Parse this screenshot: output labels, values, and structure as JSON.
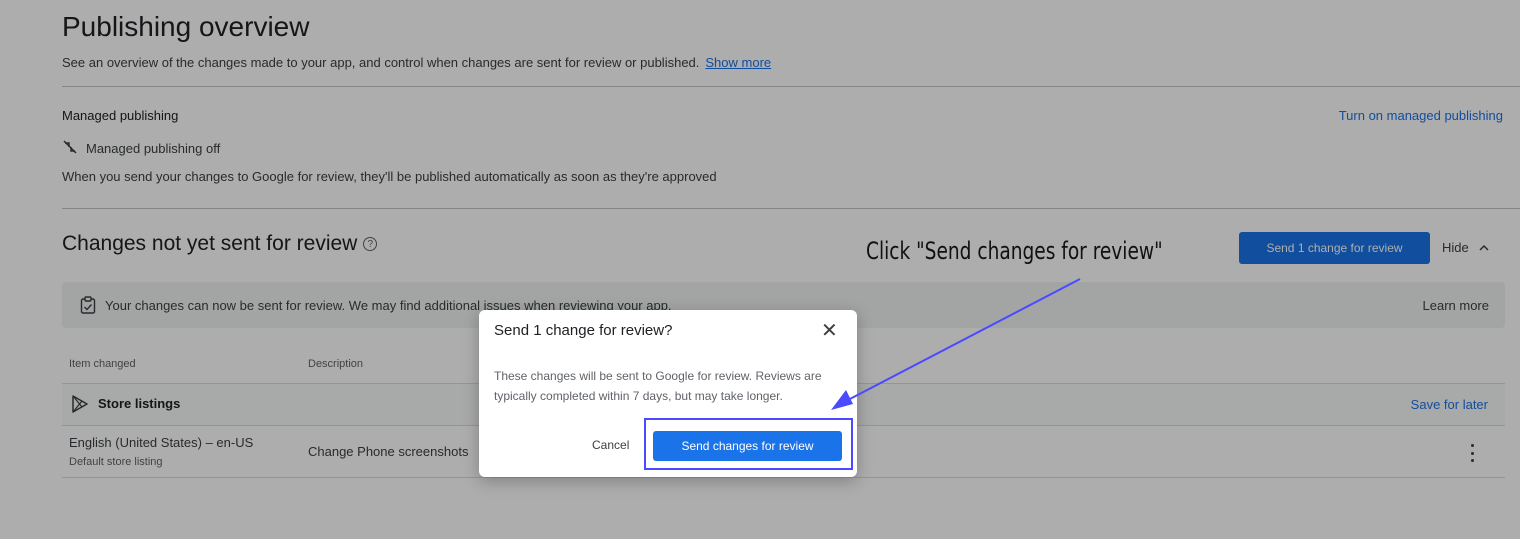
{
  "header": {
    "title": "Publishing overview",
    "subtitle": "See an overview of the changes made to your app, and control when changes are sent for review or published.",
    "show_more": "Show more"
  },
  "managed_publishing": {
    "heading": "Managed publishing",
    "turn_on_link": "Turn on managed publishing",
    "status": "Managed publishing off",
    "status_icon": "sync-off-icon",
    "description": "When you send your changes to Google for review, they'll be published automatically as soon as they're approved"
  },
  "changes_section": {
    "title": "Changes not yet sent for review",
    "help_glyph": "?",
    "send_button": "Send 1 change for review",
    "hide_button": "Hide",
    "banner_text": "Your changes can now be sent for review. We may find additional issues when reviewing your app.",
    "learn_more": "Learn more"
  },
  "table": {
    "columns": [
      "Item changed",
      "Description"
    ],
    "group": {
      "label": "Store listings",
      "icon": "play-store-icon",
      "save_for_later": "Save for later"
    },
    "rows": [
      {
        "item": "English (United States) – en-US",
        "item_sub": "Default store listing",
        "description": "Change Phone screenshots"
      }
    ]
  },
  "dialog": {
    "title": "Send 1 change for review?",
    "close_glyph": "✕",
    "body": "These changes will be sent to Google for review. Reviews are typically completed within 7 days, but may take longer.",
    "cancel": "Cancel",
    "primary": "Send changes for review"
  },
  "annotation": {
    "text": "Click \"Send changes for review\"",
    "color": "#4a4aff"
  },
  "colors": {
    "accent": "#1a73e8",
    "scrim": "rgba(0,0,0,0.32)"
  }
}
